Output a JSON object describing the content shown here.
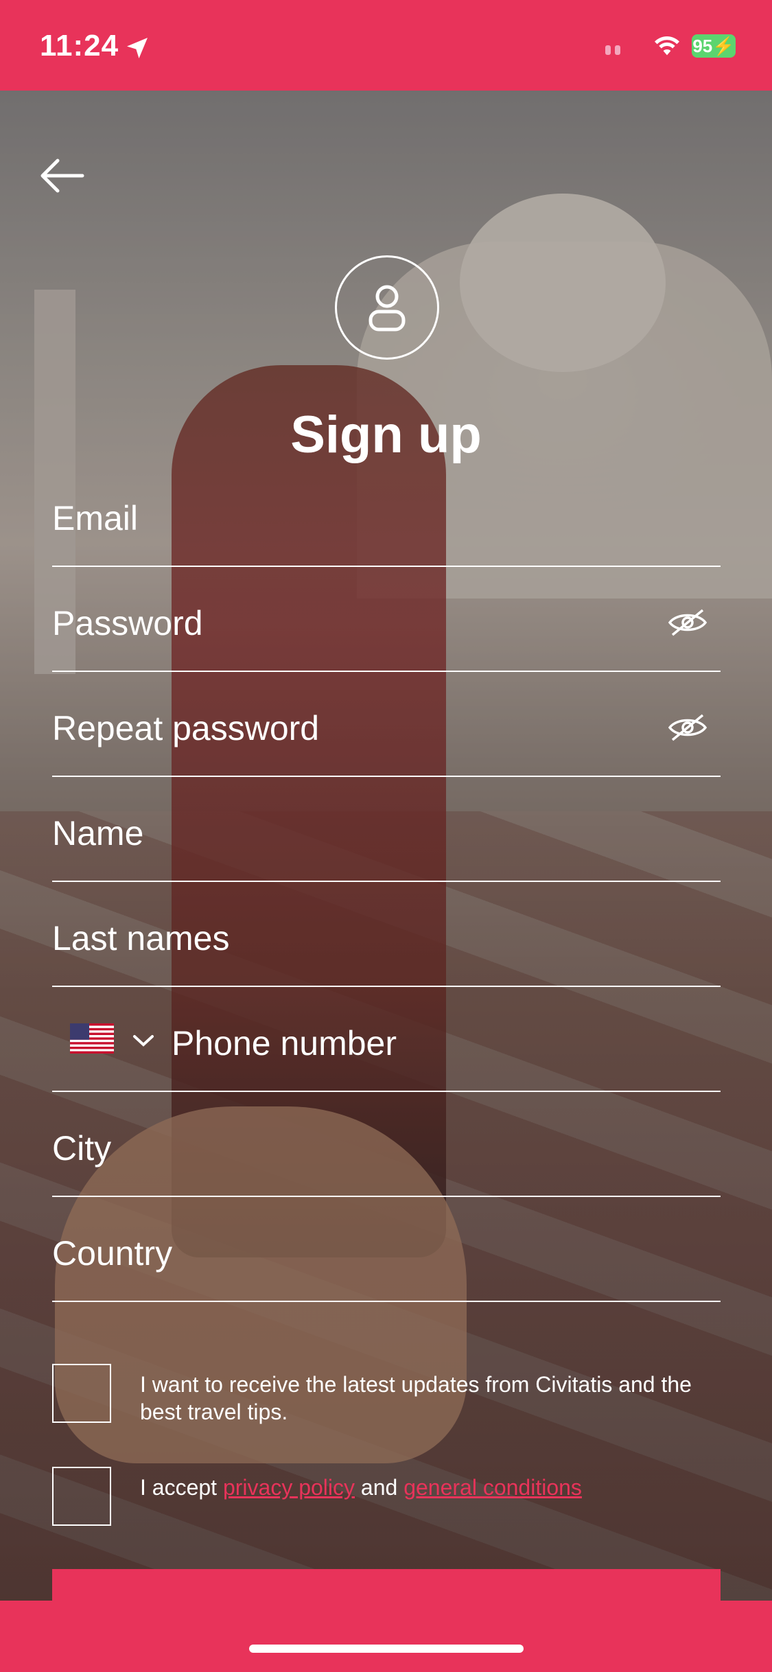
{
  "status": {
    "time": "11:24",
    "battery": "95"
  },
  "form": {
    "title": "Sign up",
    "fields": {
      "email": "Email",
      "password": "Password",
      "repeat_password": "Repeat password",
      "name": "Name",
      "last_names": "Last names",
      "phone": "Phone number",
      "city": "City",
      "country": "Country"
    },
    "checkbox_updates": "I want to receive the latest updates from Civitatis and the best travel tips.",
    "accept": {
      "prefix": "I accept ",
      "privacy_link": "privacy policy",
      "middle": " and ",
      "conditions_link": "general conditions"
    }
  },
  "colors": {
    "accent": "#e8335a"
  }
}
